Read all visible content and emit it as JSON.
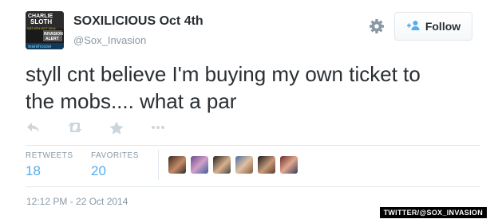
{
  "header": {
    "display_name": "SOXILICIOUS",
    "date": "Oct 4th",
    "handle": "@Sox_Invasion",
    "avatar_text": [
      "CHARLIE",
      "SLOTH",
      "SAT 4TH OCT 2014",
      "INVASION",
      "ALERT",
      "warehouse"
    ]
  },
  "follow_button": {
    "label": "Follow",
    "icon": "add-user-icon"
  },
  "settings": {
    "icon": "gear-icon"
  },
  "tweet": {
    "text": "styll cnt believe I'm buying my own ticket to\nthe mobs.... what a par"
  },
  "actions": [
    {
      "name": "reply",
      "icon": "reply-icon"
    },
    {
      "name": "retweet",
      "icon": "retweet-icon"
    },
    {
      "name": "favorite",
      "icon": "star-icon"
    },
    {
      "name": "more",
      "icon": "more-icon"
    }
  ],
  "stats": {
    "retweets_label": "RETWEETS",
    "retweets_value": "18",
    "favorites_label": "FAVORITES",
    "favorites_value": "20"
  },
  "favoriters_count": 6,
  "timestamp": "12:12 PM - 22 Oct 2014",
  "credit": "TWITTER/@SOX_INVASION",
  "colors": {
    "link": "#55acee",
    "muted": "#8899a6",
    "text": "#292f33",
    "border": "#e1e8ed"
  }
}
